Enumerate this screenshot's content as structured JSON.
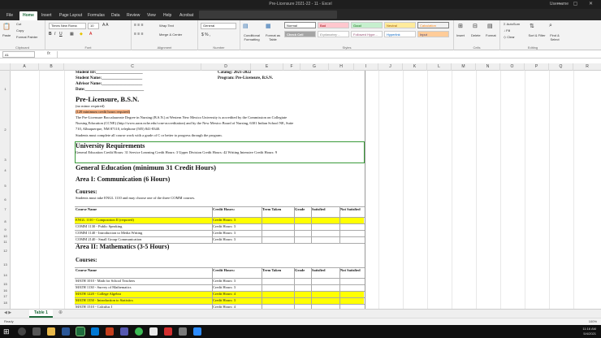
{
  "window": {
    "title": "Pre-Licensure 2021-22 - 11 - Excel",
    "user": "Username",
    "controls": "— ▢ ✕"
  },
  "ribbon_tabs": [
    "File",
    "Home",
    "Insert",
    "Page Layout",
    "Formulas",
    "Data",
    "Review",
    "View",
    "Help",
    "Acrobat"
  ],
  "ribbon": {
    "paste": "Paste",
    "cut": "Cut",
    "copy": "Copy",
    "format_painter": "Format Painter",
    "font_name": "Times New Roma",
    "font_size": "10",
    "wrap_text": "Wrap Text",
    "merge_center": "Merge & Center",
    "number_format": "General",
    "conditional_formatting": "Conditional Formatting",
    "format_as_table": "Format as Table",
    "styles": {
      "normal": "Normal",
      "bad": "Bad",
      "good": "Good",
      "neutral": "Neutral",
      "calculation": "Calculation",
      "check_cell": "Check Cell",
      "explanatory": "Explanatory ...",
      "followed_hyperlink": "Followed Hype...",
      "hyperlink": "Hyperlink",
      "input": "Input"
    },
    "insert": "Insert",
    "delete": "Delete",
    "format": "Format",
    "autosum": "AutoSum",
    "fill": "Fill",
    "clear": "Clear",
    "sort_filter": "Sort & Filter",
    "find_select": "Find & Select",
    "groups": [
      "Clipboard",
      "Font",
      "Alignment",
      "Number",
      "Styles",
      "Cells",
      "Editing"
    ]
  },
  "formula_bar": {
    "name_box": "A1",
    "fx": "fx"
  },
  "columns": [
    "A",
    "B",
    "C",
    "D",
    "E",
    "F",
    "G",
    "H",
    "I",
    "J",
    "K",
    "L",
    "M",
    "N",
    "O",
    "P",
    "Q",
    "R"
  ],
  "rows": [
    "1",
    "2",
    "3",
    "4",
    "5",
    "6",
    "7",
    "8",
    "9",
    "10",
    "11",
    "12",
    "13",
    "14",
    "15",
    "16",
    "17",
    "18"
  ],
  "doc": {
    "student_id": "Student ID:_______________________",
    "student_name": "Student Name:____________________",
    "advisor_name": "Advisor Name:____________________",
    "date": "Date:_____________________________",
    "catalog": "Catalog: 2021-2022",
    "program": "Program: Pre-Licensure, B.S.N.",
    "main_title": "Pre-Licensure, B.S.N.",
    "no_minor": "(no minor required)",
    "min_credit": "(120 minimum credit hours required)",
    "desc1": "The Pre-Licensure Baccalaureate Degree in Nursing (B.S.N.) at Western New Mexico University is accredited by the Commission on Collegiate",
    "desc2": "Nursing Education (CCNE) (http://www.aacn.nche.edu/ccne-accreditation) and by the New Mexico Board of Nursing, 6301 Indian School NE, Suite",
    "desc3": "710, Albuquerque, NM 87110, telephone (505) 841-8340.",
    "desc4": "Students must complete all course work with a grade of C or better to progress through the program.",
    "univ_req": "University Requirements",
    "univ_req_detail": "General Education Credit Hours: 31 Service Learning Credit Hours: 3 Upper Division Credit Hours: 42 Writing Intensive Credit Hours: 9",
    "gen_ed": "General Education (minimum 31 Credit Hours)",
    "area1": "Area I: Communication (6 Hours)",
    "courses_label": "Courses:",
    "area1_note": "Students must take ENGL 1110 and may choose one of the three COMM courses.",
    "area2": "Area II: Mathematics (3-5 Hours)",
    "table_headers": [
      "Course Name",
      "Credit Hours:",
      "Term Taken",
      "Grade",
      "Satisfied",
      "Not Satisfied"
    ],
    "area1_courses": [
      {
        "name": "ENGL 1110 - Composition II (required)",
        "credits": "Credit Hours: 3"
      },
      {
        "name": "COMM 1130 - Public Speaking",
        "credits": "Credit Hours: 3"
      },
      {
        "name": "COMM 1140 - Introduction to Media Writing",
        "credits": "Credit Hours: 3"
      },
      {
        "name": "COMM 2140 - Small Group Communication",
        "credits": "Credit Hours: 3"
      }
    ],
    "area2_courses": [
      {
        "name": "MATH 1010 - Math for School Teachers",
        "credits": "Credit Hours: 3"
      },
      {
        "name": "MATH 1130 - Survey of Mathematics",
        "credits": "Credit Hours: 3"
      },
      {
        "name": "MATH 1220 - College Algebra",
        "credits": "Credit Hours: 4"
      },
      {
        "name": "MATH 1350 - Introduction to Statistics",
        "credits": "Credit Hours: 3"
      },
      {
        "name": "MATH 1510 - Calculus I",
        "credits": "Credit Hours: 4"
      }
    ]
  },
  "sheet_tab": "Table 1",
  "status": {
    "ready": "Ready",
    "zoom": "100%"
  },
  "clock": {
    "time": "11:16 AM",
    "date": "5/4/2021"
  },
  "colors": {
    "accent": "#1e6b3c",
    "highlight_yellow": "#ffff00",
    "highlight_orange": "#f4b183",
    "selection_green": "#3a9a3a"
  }
}
